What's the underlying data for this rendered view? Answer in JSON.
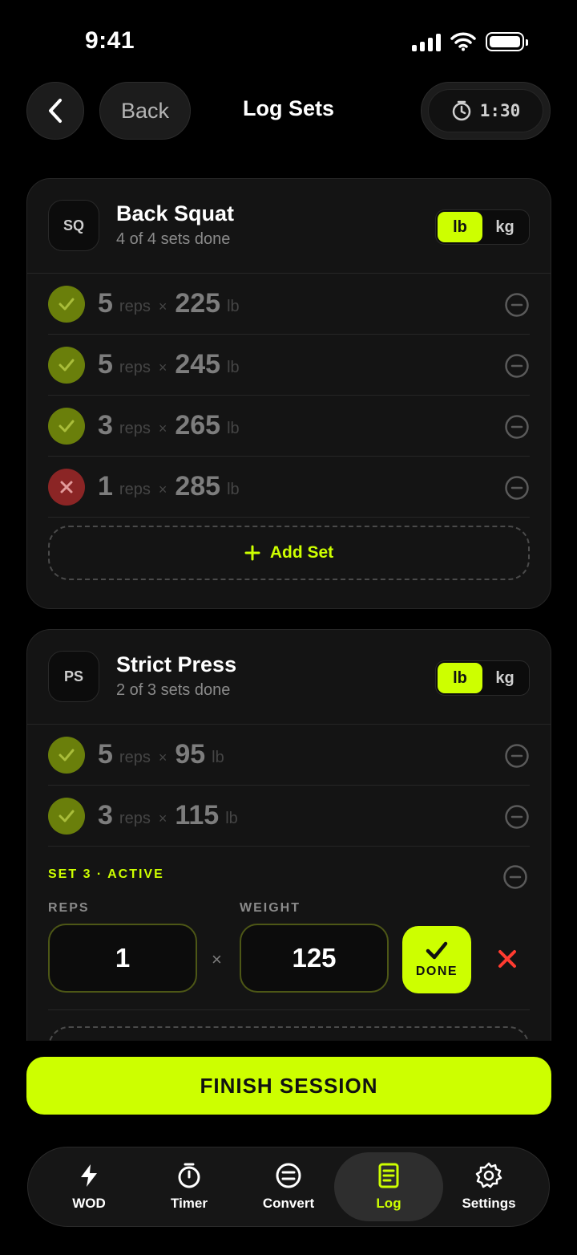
{
  "status_bar": {
    "time": "9:41"
  },
  "header": {
    "back_label": "Back",
    "title": "Log Sets",
    "timer": "1:30"
  },
  "units": {
    "lb": "lb",
    "kg": "kg"
  },
  "labels": {
    "reps": "reps",
    "times": "×",
    "add_set": "Add Set",
    "reps_field": "REPS",
    "weight_field": "WEIGHT",
    "done": "DONE"
  },
  "exercises": [
    {
      "abbr": "SQ",
      "name": "Back Squat",
      "progress": "4 of 4 sets done",
      "unit": "lb",
      "sets": [
        {
          "reps": "5",
          "weight": "225",
          "status": "done"
        },
        {
          "reps": "5",
          "weight": "245",
          "status": "done"
        },
        {
          "reps": "3",
          "weight": "265",
          "status": "done"
        },
        {
          "reps": "1",
          "weight": "285",
          "status": "failed"
        }
      ]
    },
    {
      "abbr": "PS",
      "name": "Strict Press",
      "progress": "2 of 3 sets done",
      "unit": "lb",
      "sets": [
        {
          "reps": "5",
          "weight": "95",
          "status": "done"
        },
        {
          "reps": "3",
          "weight": "115",
          "status": "done"
        }
      ],
      "active_set": {
        "label": "SET 3 · ACTIVE",
        "reps": "1",
        "weight": "125"
      }
    }
  ],
  "finish_label": "FINISH SESSION",
  "tabs": [
    {
      "label": "WOD",
      "icon": "bolt-icon"
    },
    {
      "label": "Timer",
      "icon": "stopwatch-icon"
    },
    {
      "label": "Convert",
      "icon": "equals-circle-icon"
    },
    {
      "label": "Log",
      "icon": "notepad-icon",
      "active": true
    },
    {
      "label": "Settings",
      "icon": "gear-icon"
    }
  ],
  "colors": {
    "accent": "#cdff00",
    "done": "#6a7f0b",
    "failed": "#8b2525",
    "cancel": "#ff3b30"
  }
}
